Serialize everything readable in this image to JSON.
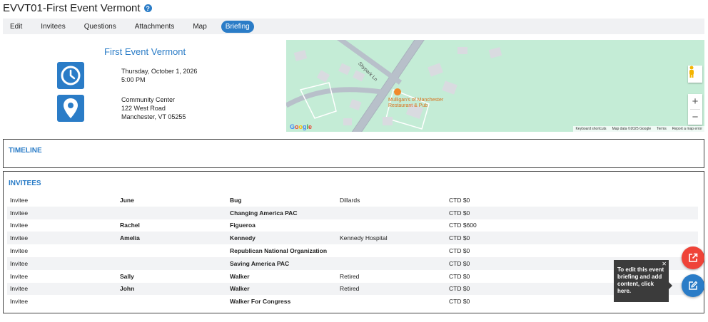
{
  "page": {
    "title": "EVVT01-First Event Vermont",
    "help_glyph": "?"
  },
  "tabs": [
    {
      "label": "Edit",
      "active": false
    },
    {
      "label": "Invitees",
      "active": false
    },
    {
      "label": "Questions",
      "active": false
    },
    {
      "label": "Attachments",
      "active": false
    },
    {
      "label": "Map",
      "active": false
    },
    {
      "label": "Briefing",
      "active": true
    }
  ],
  "event": {
    "name": "First Event Vermont",
    "date": "Thursday, October 1, 2026",
    "time": "5:00 PM",
    "venue": "Community Center",
    "street": "122 West Road",
    "city": "Manchester, VT 05255",
    "clock_icon": "clock-icon",
    "pin_icon": "map-pin-icon"
  },
  "map": {
    "place_label_1": "Mulligan's of Manchester",
    "place_label_2": "Restaurant & Pub",
    "street_label": "Skypark Ln",
    "logo": "Google",
    "footer": {
      "shortcuts": "Keyboard shortcuts",
      "data": "Map data ©2025 Google",
      "terms": "Terms",
      "report": "Report a map error"
    },
    "zoom_in": "+",
    "zoom_out": "−"
  },
  "timeline": {
    "title": "TIMELINE"
  },
  "invitees": {
    "title": "INVITEES",
    "rows": [
      {
        "role": "Invitee",
        "first": "June",
        "last": "Bug",
        "org": "Dillards",
        "ctd": "CTD $0"
      },
      {
        "role": "Invitee",
        "first": "",
        "last": "Changing America PAC",
        "org": "",
        "ctd": "CTD $0"
      },
      {
        "role": "Invitee",
        "first": "Rachel",
        "last": "Figueroa",
        "org": "",
        "ctd": "CTD $600"
      },
      {
        "role": "Invitee",
        "first": "Amelia",
        "last": "Kennedy",
        "org": "Kennedy Hospital",
        "ctd": "CTD $0"
      },
      {
        "role": "Invitee",
        "first": "",
        "last": "Republican National Organization",
        "org": "",
        "ctd": "CTD $0"
      },
      {
        "role": "Invitee",
        "first": "",
        "last": "Saving America PAC",
        "org": "",
        "ctd": "CTD $0"
      },
      {
        "role": "Invitee",
        "first": "Sally",
        "last": "Walker",
        "org": "Retired",
        "ctd": "CTD $0"
      },
      {
        "role": "Invitee",
        "first": "John",
        "last": "Walker",
        "org": "Retired",
        "ctd": "CTD $0"
      },
      {
        "role": "Invitee",
        "first": "",
        "last": "Walker For Congress",
        "org": "",
        "ctd": "CTD $0"
      }
    ]
  },
  "tooltip": {
    "text": "To edit this event briefing and add content, click here.",
    "close_glyph": "✕"
  },
  "colors": {
    "accent": "#2a7cc7",
    "share_fab": "#ef4338",
    "map_bg": "#c4ecd6"
  }
}
